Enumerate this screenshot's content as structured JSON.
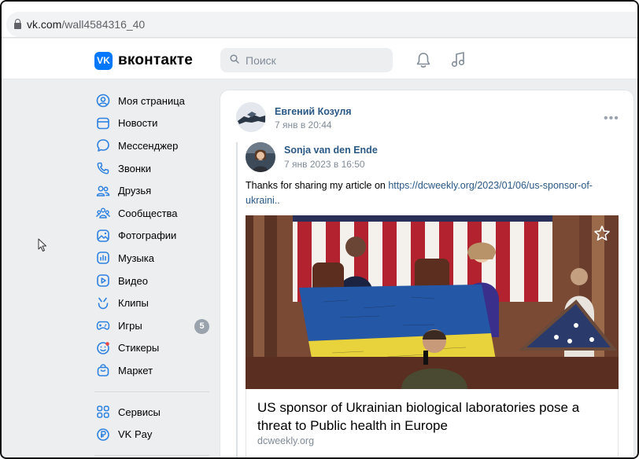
{
  "browser": {
    "url_domain": "vk.com",
    "url_path": "/wall4584316_40"
  },
  "header": {
    "logo_mark": "VK",
    "logo_text": "вконтакте",
    "search_placeholder": "Поиск",
    "icons": [
      "bell-icon",
      "music-note-icon"
    ]
  },
  "sidebar": {
    "items": [
      {
        "label": "Моя страница",
        "icon": "user-circle-icon"
      },
      {
        "label": "Новости",
        "icon": "news-icon"
      },
      {
        "label": "Мессенджер",
        "icon": "message-bubble-icon"
      },
      {
        "label": "Звонки",
        "icon": "phone-icon"
      },
      {
        "label": "Друзья",
        "icon": "friends-icon"
      },
      {
        "label": "Сообщества",
        "icon": "communities-icon"
      },
      {
        "label": "Фотографии",
        "icon": "photo-icon"
      },
      {
        "label": "Музыка",
        "icon": "music-icon"
      },
      {
        "label": "Видео",
        "icon": "video-icon"
      },
      {
        "label": "Клипы",
        "icon": "clips-icon"
      },
      {
        "label": "Игры",
        "icon": "gamepad-icon",
        "badge": "5"
      },
      {
        "label": "Стикеры",
        "icon": "sticker-icon"
      },
      {
        "label": "Маркет",
        "icon": "market-bag-icon"
      }
    ],
    "extra_items": [
      {
        "label": "Сервисы",
        "icon": "services-icon"
      },
      {
        "label": "VK Pay",
        "icon": "vk-pay-icon"
      }
    ]
  },
  "post": {
    "author": "Евгений Козуля",
    "date": "7 янв в 20:44",
    "menu": "•••",
    "repost": {
      "author": "Sonja van den Ende",
      "date": "7 янв 2023 в 16:50",
      "text_prefix": "Thanks for sharing my article on ",
      "link_text": "https://dcweekly.org/2023/01/06/us-sponsor-of-ukraini..",
      "attachment": {
        "title": "US sponsor of Ukrainian biological laboratories pose a threat to Public health in Europe",
        "domain": "dcweekly.org"
      }
    }
  },
  "colors": {
    "vk_blue": "#0077ff",
    "link": "#2a5885",
    "secondary_text": "#818c99",
    "page_bg": "#edeef0"
  }
}
